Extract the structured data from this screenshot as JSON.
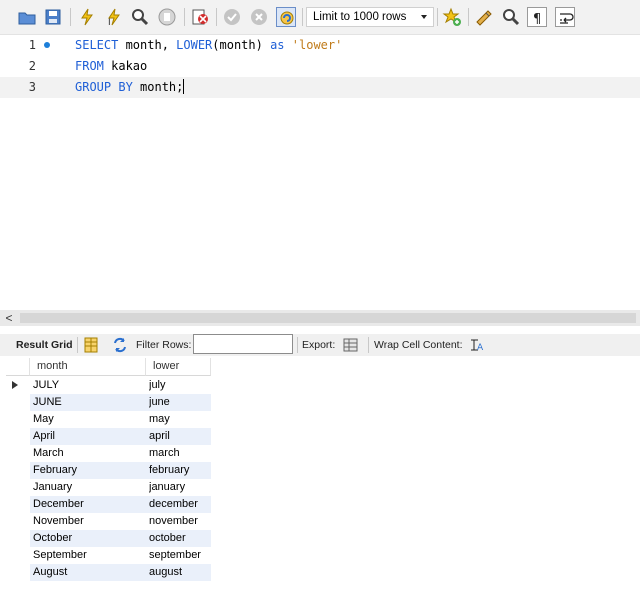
{
  "toolbar": {
    "buttons": [
      {
        "name": "open-folder-icon",
        "color": "#3a6fb8"
      },
      {
        "name": "save-icon",
        "color": "#3a6fb8"
      },
      {
        "name": "execute-icon",
        "color": "#e8b400"
      },
      {
        "name": "execute-current-icon",
        "color": "#e8b400"
      },
      {
        "name": "explain-icon",
        "color": "#444444"
      },
      {
        "name": "stop-icon",
        "color": "#999999"
      },
      {
        "name": "toggle-error-icon",
        "color": "#d22b2b"
      },
      {
        "name": "commit-icon",
        "color": "#aaaaaa"
      },
      {
        "name": "rollback-icon",
        "color": "#aaaaaa"
      },
      {
        "name": "autocommit-icon",
        "color": "#2a6fcf"
      },
      {
        "name": "bookmark-icon",
        "color": "#e8b400"
      },
      {
        "name": "beautify-icon",
        "color": "#c07b1a"
      },
      {
        "name": "find-icon",
        "color": "#444444"
      },
      {
        "name": "invisible-chars-icon",
        "color": "#222222"
      },
      {
        "name": "wrap-icon",
        "color": "#222222"
      }
    ],
    "limit_label": "Limit to 1000 rows"
  },
  "editor": {
    "lines": [
      {
        "number": "1"
      },
      {
        "number": "2"
      },
      {
        "number": "3"
      }
    ],
    "tokens": {
      "l1_kw1": "SELECT",
      "l1_t1": " month, ",
      "l1_fn": "LOWER",
      "l1_t2": "(month) ",
      "l1_kw2": "as",
      "l1_sp": " ",
      "l1_str": "'lower'",
      "l2_kw": "FROM",
      "l2_t": " kakao",
      "l3_kw": "GROUP BY",
      "l3_t": " month;"
    }
  },
  "scrollbar": {
    "left_arrow": "<"
  },
  "result_toolbar": {
    "result_grid": "Result Grid",
    "filter_rows": "Filter Rows:",
    "filter_value": "",
    "export": "Export:",
    "wrap_cell": "Wrap Cell Content:"
  },
  "grid": {
    "columns": [
      "month",
      "lower"
    ],
    "rows": [
      [
        "JULY",
        "july"
      ],
      [
        "JUNE",
        "june"
      ],
      [
        "May",
        "may"
      ],
      [
        "April",
        "april"
      ],
      [
        "March",
        "march"
      ],
      [
        "February",
        "february"
      ],
      [
        "January",
        "january"
      ],
      [
        "December",
        "december"
      ],
      [
        "November",
        "november"
      ],
      [
        "October",
        "october"
      ],
      [
        "September",
        "september"
      ],
      [
        "August",
        "august"
      ]
    ]
  }
}
